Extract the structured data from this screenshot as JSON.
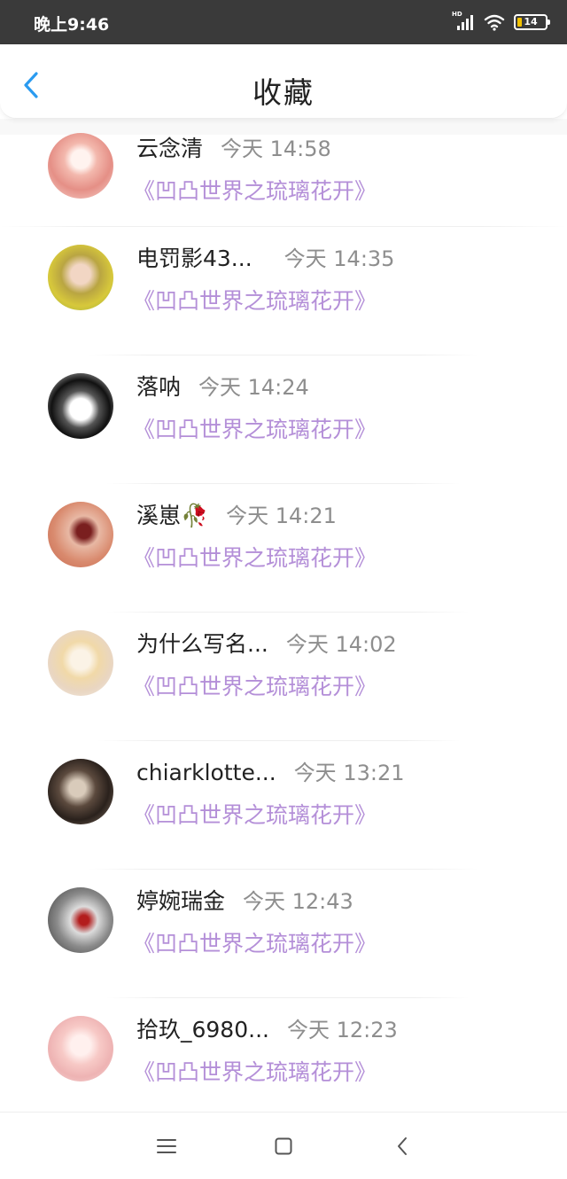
{
  "status": {
    "time": "晚上9:46",
    "network_label": "HD",
    "battery_level": "14",
    "battery_color": "#f2c200"
  },
  "header": {
    "back_icon": "chevron-left-icon",
    "title": "收藏",
    "accent": "#2a9bf0"
  },
  "items": [
    {
      "name": "云念清",
      "time": "今天 14:58",
      "work": "《凹凸世界之琉璃花开》"
    },
    {
      "name": "电罚影43...",
      "time": "今天 14:35",
      "work": "《凹凸世界之琉璃花开》"
    },
    {
      "name": "落呐",
      "time": "今天 14:24",
      "work": "《凹凸世界之琉璃花开》"
    },
    {
      "name": "溪崽🥀",
      "time": "今天 14:21",
      "work": "《凹凸世界之琉璃花开》"
    },
    {
      "name": "为什么写名...",
      "time": "今天 14:02",
      "work": "《凹凸世界之琉璃花开》"
    },
    {
      "name": "chiarklotte...",
      "time": "今天 13:21",
      "work": "《凹凸世界之琉璃花开》"
    },
    {
      "name": "婷婉瑞金",
      "time": "今天 12:43",
      "work": "《凹凸世界之琉璃花开》"
    },
    {
      "name": "拾玖_6980...",
      "time": "今天 12:23",
      "work": "《凹凸世界之琉璃花开》"
    }
  ],
  "nav": {
    "menu_icon": "menu-icon",
    "home_icon": "home-square-icon",
    "back_icon": "back-triangle-icon"
  },
  "colors": {
    "work_title": "#b48fd8",
    "time_text": "#8e8e8e"
  }
}
